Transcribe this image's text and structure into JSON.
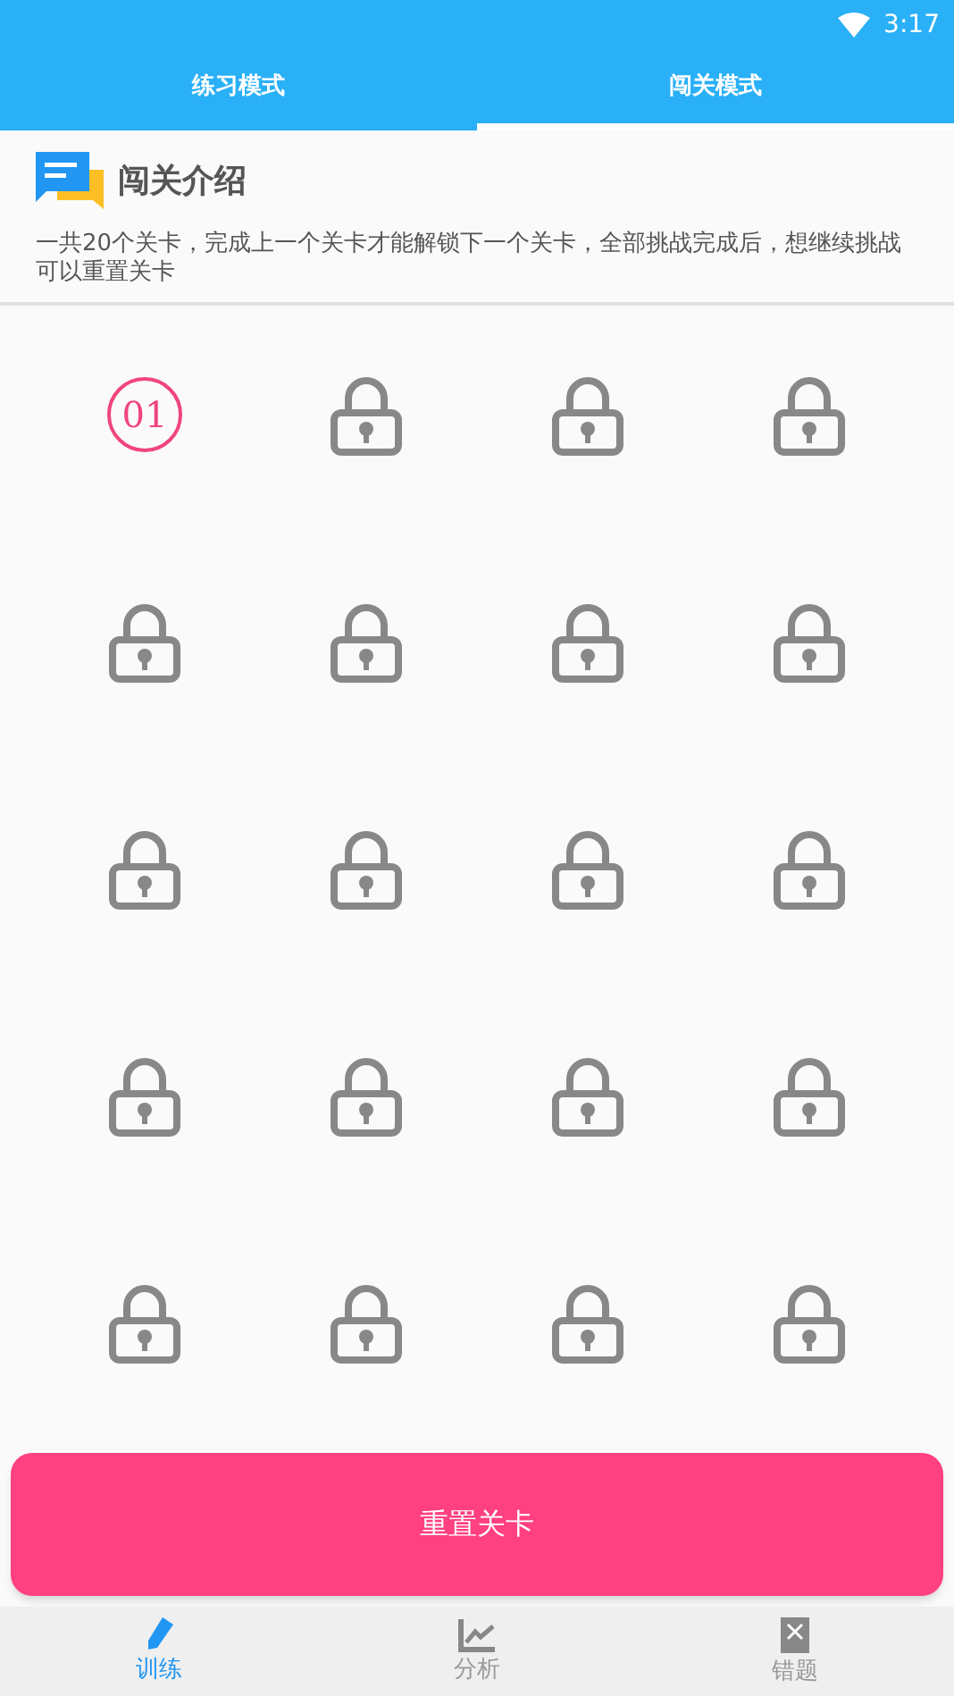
{
  "status_bar": {
    "time": "3:17"
  },
  "tabs": [
    {
      "label": "练习模式",
      "selected": false
    },
    {
      "label": "闯关模式",
      "selected": true
    }
  ],
  "intro": {
    "title": "闯关介绍",
    "text": "一共20个关卡，完成上一个关卡才能解锁下一个关卡，全部挑战完成后，想继续挑战可以重置关卡"
  },
  "levels": [
    {
      "locked": false,
      "label": "01"
    },
    {
      "locked": true
    },
    {
      "locked": true
    },
    {
      "locked": true
    },
    {
      "locked": true
    },
    {
      "locked": true
    },
    {
      "locked": true
    },
    {
      "locked": true
    },
    {
      "locked": true
    },
    {
      "locked": true
    },
    {
      "locked": true
    },
    {
      "locked": true
    },
    {
      "locked": true
    },
    {
      "locked": true
    },
    {
      "locked": true
    },
    {
      "locked": true
    },
    {
      "locked": true
    },
    {
      "locked": true
    },
    {
      "locked": true
    },
    {
      "locked": true
    }
  ],
  "reset_button": {
    "label": "重置关卡"
  },
  "bottom_nav": [
    {
      "label": "训练",
      "selected": true,
      "kind": "pen"
    },
    {
      "label": "分析",
      "selected": false,
      "kind": "chart"
    },
    {
      "label": "错题",
      "selected": false,
      "kind": "wrong"
    }
  ]
}
